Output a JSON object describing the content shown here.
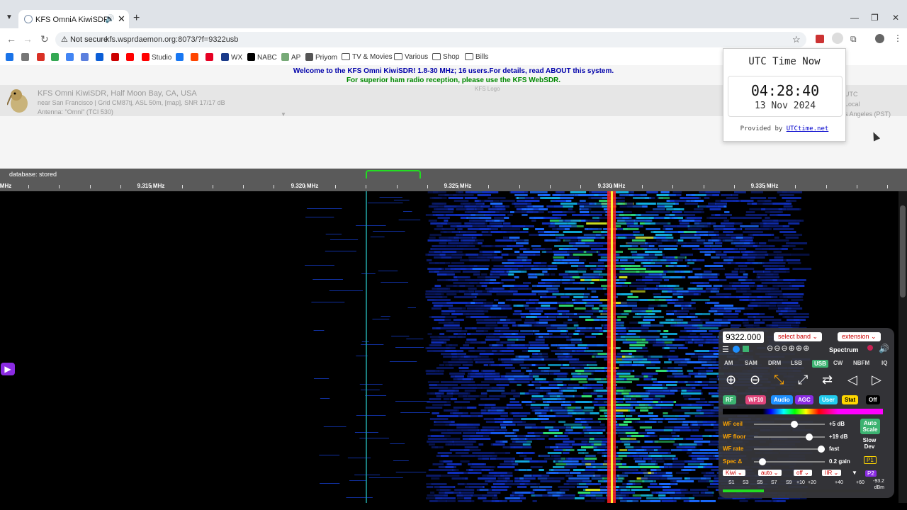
{
  "browser": {
    "tab_title": "KFS OmniA KiwiSDR",
    "new_tab": "+",
    "address": {
      "security": "Not secure",
      "url": "kfs.wsprdaemon.org:8073/?f=9322usb"
    },
    "bookmarks": [
      {
        "label": "",
        "color": "#1a73e8"
      },
      {
        "label": "",
        "color": "#777"
      },
      {
        "label": "",
        "color": "#d93025"
      },
      {
        "label": "",
        "color": "#34a853"
      },
      {
        "label": "",
        "color": "#4285f4"
      },
      {
        "label": "",
        "color": "#5b7fde"
      },
      {
        "label": "",
        "color": "#0b5ed7"
      },
      {
        "label": "",
        "color": "#c00"
      },
      {
        "label": "",
        "color": "#ff0000"
      },
      {
        "label": "Studio",
        "color": "#ff0000"
      },
      {
        "label": "",
        "color": "#1877f2"
      },
      {
        "label": "",
        "color": "#ff4500"
      },
      {
        "label": "",
        "color": "#e60023"
      },
      {
        "label": "WX",
        "color": "#1a3a8a"
      },
      {
        "label": "NABC",
        "color": "#000"
      },
      {
        "label": "AP",
        "color": "#7a7"
      },
      {
        "label": "Priyom",
        "color": "#555"
      },
      {
        "label": "TV & Movies",
        "color": "folder"
      },
      {
        "label": "Various",
        "color": "folder"
      },
      {
        "label": "Shop",
        "color": "folder"
      },
      {
        "label": "Bills",
        "color": "folder"
      }
    ]
  },
  "header": {
    "welcome": "Welcome to the KFS Omni KiwiSDR! 1.8-30 MHz; 16 users.For details, read ABOUT this system.",
    "superior": "For superior ham radio reception, please use the KFS WebSDR.",
    "station_name": "KFS Omni KiwiSDR, Half Moon Bay, CA, USA",
    "station_loc": "near San Francisco | Grid CM87tj, ASL 50m, [map], SNR 17/17 dB",
    "station_ant": "Antenna: \"Omni\" (TCI 530)",
    "logo_alt": "KFS Logo",
    "right_peek": [
      "UTC",
      "Local",
      "s Angeles (PST)"
    ]
  },
  "utc": {
    "title": "UTC Time Now",
    "time": "04:28:40",
    "date": "13 Nov 2024",
    "provided_prefix": "Provided by ",
    "provided_link": "UTCtime.net"
  },
  "scale": {
    "db_status": "database: stored",
    "edge_left": "MHz",
    "labels": [
      "9.315 MHz",
      "9.320 MHz",
      "9.325 MHz",
      "9.330 MHz",
      "9.335 MHz"
    ]
  },
  "panel": {
    "frequency": "9322.000",
    "select_band": "select band",
    "extension": "extension",
    "spectrum": "Spectrum",
    "modes": [
      "AM",
      "SAM",
      "DRM",
      "LSB",
      "USB",
      "CW",
      "NBFM",
      "IQ"
    ],
    "active_mode": "USB",
    "tabs": [
      {
        "label": "RF",
        "bg": "#3cb371",
        "fg": "#fff"
      },
      {
        "label": "WF10",
        "bg": "#e0457b",
        "fg": "#fff"
      },
      {
        "label": "Audio",
        "bg": "#1e90ff",
        "fg": "#fff"
      },
      {
        "label": "AGC",
        "bg": "#8a2be2",
        "fg": "#fff"
      },
      {
        "label": "User",
        "bg": "#22ccee",
        "fg": "#fff"
      },
      {
        "label": "Stat",
        "bg": "#ffd700",
        "fg": "#000"
      },
      {
        "label": "Off",
        "bg": "#000",
        "fg": "#fff"
      }
    ],
    "sliders": [
      {
        "label": "WF ceil",
        "value": "+5 dB",
        "pos": 0.57
      },
      {
        "label": "WF floor",
        "value": "+19 dB",
        "pos": 0.78
      },
      {
        "label": "WF rate",
        "value": "fast",
        "pos": 0.95
      },
      {
        "label": "Spec Δ",
        "value": "0.2 gain",
        "pos": 0.12
      }
    ],
    "auto_scale": "Auto Scale",
    "slow_dev": "Slow Dev",
    "p1": "P1",
    "p2": "P2",
    "selects": [
      "Kiwi",
      "auto",
      "off",
      "IIR"
    ],
    "smeter_labels": [
      "S1",
      "S3",
      "S5",
      "S7",
      "S9",
      "+10",
      "+20",
      "+40",
      "+60"
    ],
    "dbm_value": "-93.2",
    "dbm_unit": "dBm",
    "smeter_level": 0.28
  }
}
